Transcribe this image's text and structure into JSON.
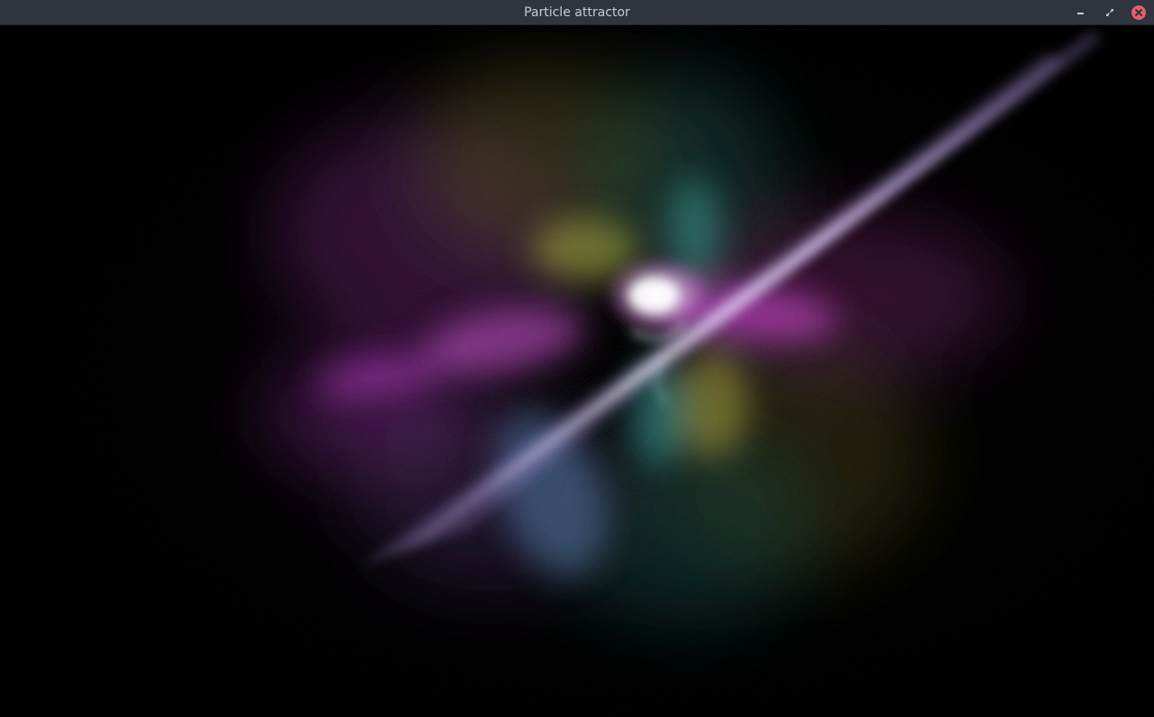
{
  "window": {
    "title": "Particle attractor",
    "controls": {
      "minimize_icon": "minimize-icon",
      "maximize_icon": "maximize-icon",
      "close_icon": "close-icon"
    },
    "colors": {
      "titlebar": "#2f343f",
      "title_text": "#c6cbd3",
      "close": "#e0616d"
    }
  },
  "canvas": {
    "background": "#000000",
    "palette": [
      "#ff66ff",
      "#c86be8",
      "#ffffff",
      "#e8e070",
      "#5ad0c8",
      "#7fb6ff"
    ]
  }
}
